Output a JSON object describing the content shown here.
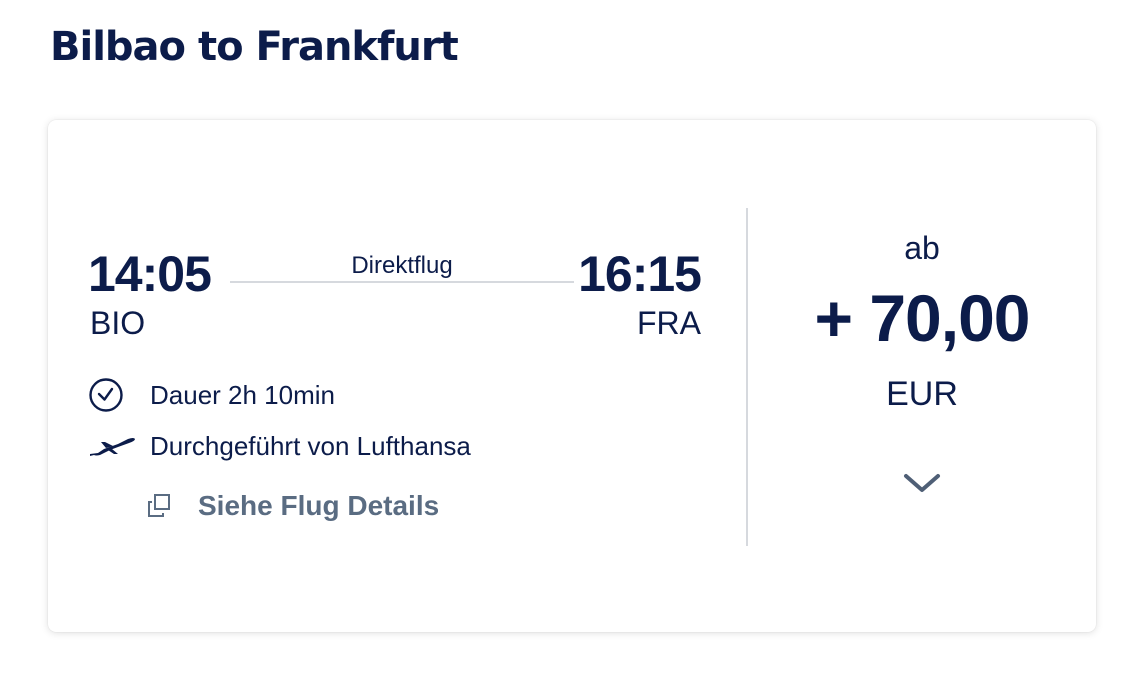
{
  "title": "Bilbao to Frankfurt",
  "flight": {
    "departure_time": "14:05",
    "departure_code": "BIO",
    "arrival_time": "16:15",
    "arrival_code": "FRA",
    "stop_label": "Direktflug",
    "duration": "Dauer 2h 10min",
    "operator": "Durchgeführt von Lufthansa",
    "details_link": "Siehe Flug Details"
  },
  "price": {
    "prefix": "ab",
    "value": "+ 70,00",
    "currency": "EUR"
  },
  "icons": {
    "duration": "clock-icon",
    "operator": "plane-icon",
    "details": "copy-icon",
    "expand": "chevron-down-icon"
  },
  "colors": {
    "primary_text": "#0c1c4a",
    "link_text": "#5a6c82",
    "divider": "#d6d9de"
  }
}
